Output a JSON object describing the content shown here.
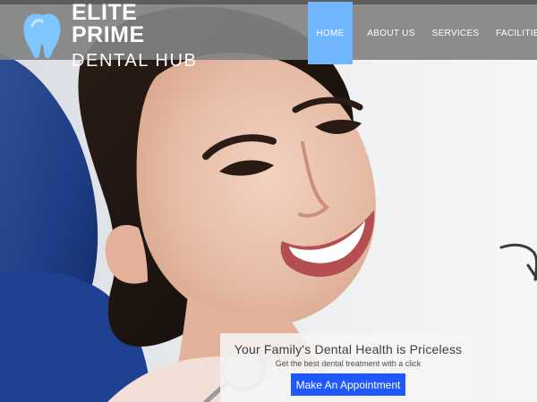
{
  "brand": {
    "line1": "ELITE PRIME",
    "line2": "DENTAL HUB",
    "logo_icon": "tooth-icon",
    "colors": {
      "tooth": "#7fc6ff",
      "text": "#ffffff"
    }
  },
  "nav": {
    "items": [
      {
        "label": "HOME",
        "active": true
      },
      {
        "label": "ABOUT US",
        "active": false
      },
      {
        "label": "SERVICES",
        "active": false
      },
      {
        "label": "FACILITIES",
        "active": false
      }
    ],
    "colors": {
      "bar": "#828282",
      "active": "#6fb6ff"
    }
  },
  "hero": {
    "caption": {
      "title": "Your Family's Dental Health is Priceless",
      "subtitle": "Get the best dental treatment with a click",
      "button_label": "Make An Appointment",
      "button_color": "#1f58ff"
    }
  }
}
